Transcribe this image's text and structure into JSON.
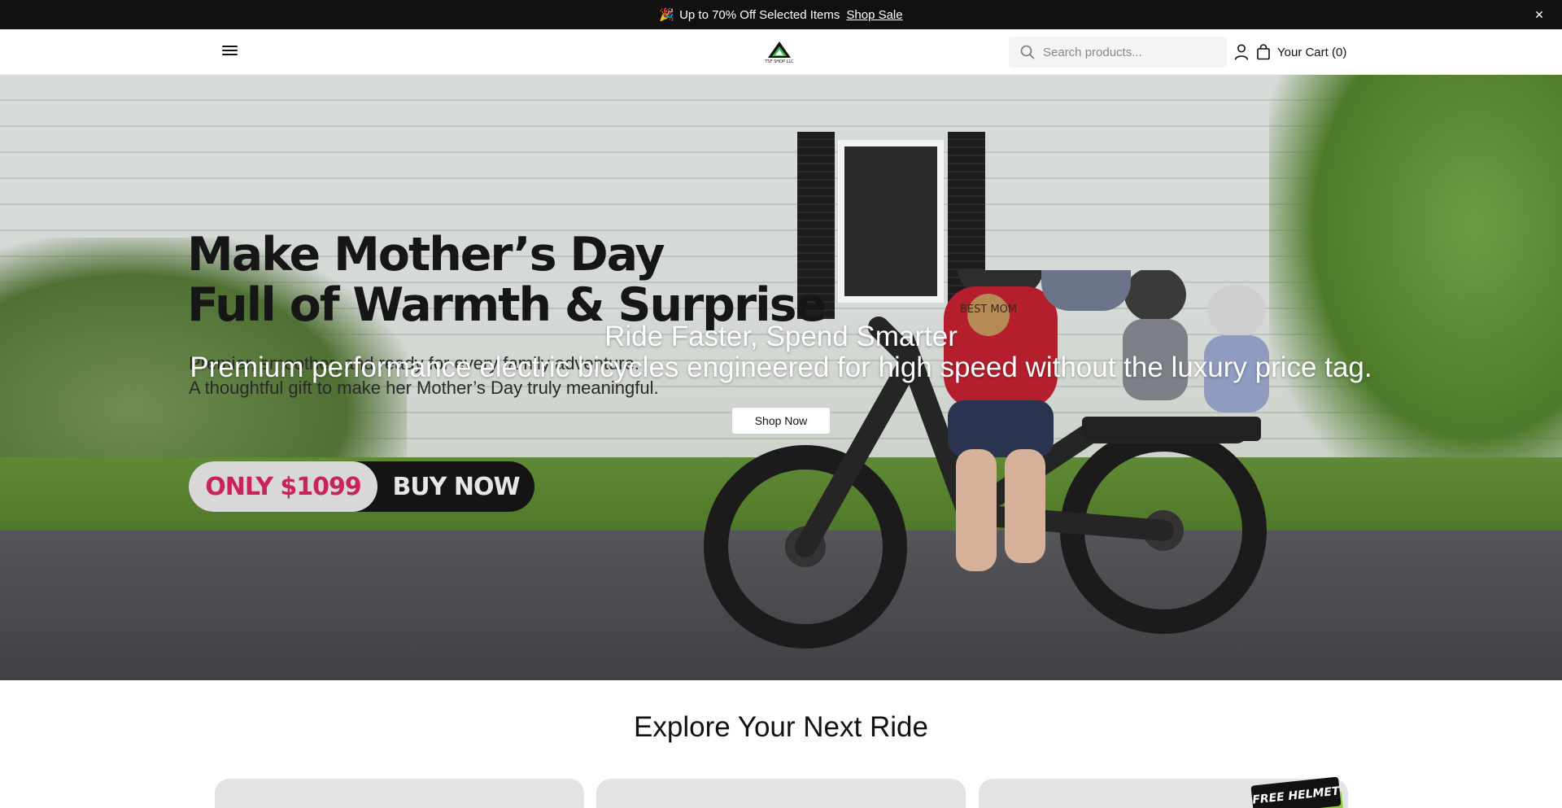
{
  "announcement": {
    "emoji": "🎉",
    "text": "Up to 70% Off Selected Items",
    "link_label": "Shop Sale",
    "close_glyph": "✕"
  },
  "header": {
    "logo_text": "TSF SHOP LLC",
    "search_placeholder": "Search products...",
    "cart_label": "Your Cart (0)"
  },
  "hero": {
    "promo": {
      "title_line1": "Make Mother’s Day",
      "title_line2": "Full of Warmth & Surprise",
      "sub_line1": "Premier, smoother, and ready for every family adventure.",
      "sub_line2": "A thoughtful gift to make her Mother’s Day truly meaningful.",
      "price_label": "ONLY $1099",
      "buy_label": "BUY NOW",
      "medal_text": "BEST MOM",
      "price_color": "#c8245b"
    },
    "heading": "Ride Faster, Spend Smarter",
    "subheading": "Premium performance electric bicycles engineered for high speed without the luxury price tag.",
    "button_label": "Shop Now"
  },
  "collection": {
    "title": "Explore Your Next Ride",
    "badge_text": "FREE HELMET"
  },
  "colors": {
    "announcement_bg": "#111111",
    "badge_green": "#8dd13a"
  }
}
